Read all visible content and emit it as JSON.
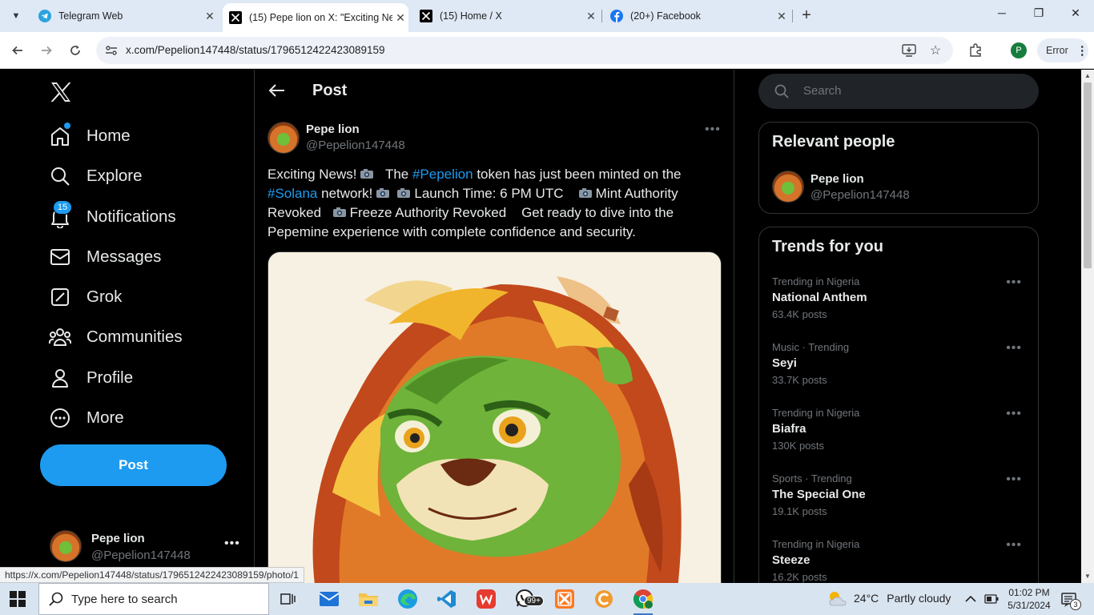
{
  "browser": {
    "tabs": [
      {
        "title": "Telegram Web",
        "icon": "telegram-icon",
        "active": false
      },
      {
        "title": "(15) Pepe lion on X: \"Exciting Ne",
        "icon": "x-icon",
        "active": true
      },
      {
        "title": "(15) Home / X",
        "icon": "x-icon",
        "active": false
      },
      {
        "title": "(20+) Facebook",
        "icon": "facebook-icon",
        "active": false
      }
    ],
    "url": "x.com/Pepelion147448/status/1796512422423089159",
    "profile_initial": "P",
    "error_label": "Error"
  },
  "nav": {
    "items": [
      {
        "label": "Home",
        "icon": "home-icon"
      },
      {
        "label": "Explore",
        "icon": "search-icon"
      },
      {
        "label": "Notifications",
        "icon": "bell-icon",
        "badge": "15"
      },
      {
        "label": "Messages",
        "icon": "mail-icon"
      },
      {
        "label": "Grok",
        "icon": "grok-icon"
      },
      {
        "label": "Communities",
        "icon": "communities-icon"
      },
      {
        "label": "Profile",
        "icon": "person-icon"
      },
      {
        "label": "More",
        "icon": "more-circle-icon"
      }
    ],
    "post_button": "Post",
    "account": {
      "name": "Pepe lion",
      "handle": "@Pepelion147448"
    }
  },
  "post": {
    "header_title": "Post",
    "author": {
      "name": "Pepe lion",
      "handle": "@Pepelion147448"
    },
    "text": {
      "p1": "Exciting News!",
      "p2": "The",
      "hashtag1": "#Pepelion",
      "p3": "token has just been minted on the",
      "hashtag2": "#Solana",
      "p4": "network!",
      "p5": "Launch Time: 6 PM UTC",
      "p6": "Mint Authority Revoked",
      "p7": "Freeze Authority Revoked",
      "p8": "Get ready to dive into the Pepemine experience with complete confidence and security."
    }
  },
  "right": {
    "search_placeholder": "Search",
    "relevant": {
      "title": "Relevant people",
      "name": "Pepe lion",
      "handle": "@Pepelion147448"
    },
    "trends": {
      "title": "Trends for you",
      "items": [
        {
          "context": "Trending in Nigeria",
          "name": "National Anthem",
          "count": "63.4K posts"
        },
        {
          "context": "Music · Trending",
          "name": "Seyi",
          "count": "33.7K posts"
        },
        {
          "context": "Trending in Nigeria",
          "name": "Biafra",
          "count": "130K posts"
        },
        {
          "context": "Sports · Trending",
          "name": "The Special One",
          "count": "19.1K posts"
        },
        {
          "context": "Trending in Nigeria",
          "name": "Steeze",
          "count": "16.2K posts"
        }
      ]
    }
  },
  "status_url": "https://x.com/Pepelion147448/status/1796512422423089159/photo/1",
  "taskbar": {
    "search_placeholder": "Type here to search",
    "whatsapp_badge": "99+",
    "weather_temp": "24°C",
    "weather_desc": "Partly cloudy",
    "time": "01:02 PM",
    "date": "5/31/2024",
    "notification_count": "3"
  }
}
